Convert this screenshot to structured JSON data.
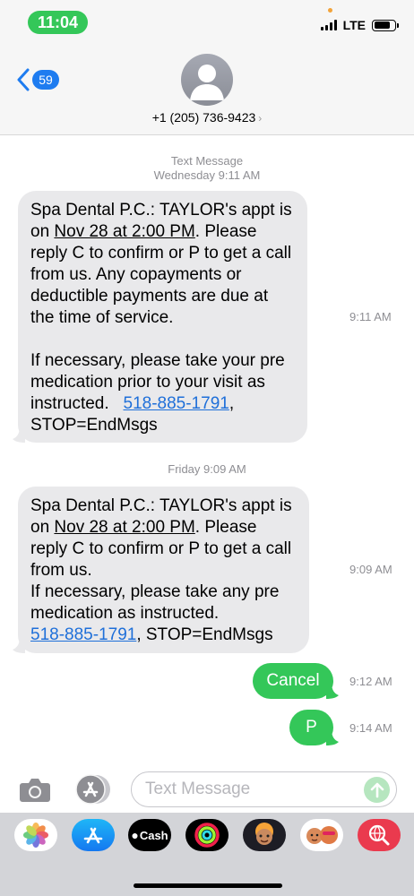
{
  "status_bar": {
    "time": "11:04",
    "network": "LTE",
    "battery_level": 0.8
  },
  "header": {
    "back_count": "59",
    "contact_number": "+1 (205) 736-9423",
    "chevron": "›"
  },
  "conversation": {
    "stamp1_label": "Text Message",
    "stamp1_time": "Wednesday 9:11 AM",
    "msg1": {
      "p1_a": "Spa Dental P.C.: TAYLOR's appt is on ",
      "p1_date": "Nov 28 at 2:00 PM",
      "p1_b": ". Please reply C to confirm or P to get a call from us. Any copayments or deductible payments are due at the time of service.",
      "p2_a": "If necessary, please take your pre medication prior to your visit as instructed.   ",
      "p2_phone": "518-885-1791",
      "p2_b": ", STOP=EndMsgs",
      "time": "9:11 AM"
    },
    "stamp2_time": "Friday 9:09 AM",
    "msg2": {
      "p1_a": "Spa Dental P.C.: TAYLOR's appt is on ",
      "p1_date": "Nov 28 at 2:00 PM",
      "p1_b": ". Please reply C to confirm or P to get a call from us.",
      "p2_a": "If necessary, please take any pre medication as instructed.",
      "p2_phone": "518-885-1791",
      "p2_b": ", STOP=EndMsgs",
      "time": "9:09 AM"
    },
    "msg3": {
      "text": "Cancel",
      "time": "9:12 AM"
    },
    "msg4": {
      "text": "P",
      "time": "9:14 AM"
    }
  },
  "compose": {
    "placeholder": "Text Message"
  },
  "app_drawer": {
    "apps": [
      {
        "name": "photos-icon"
      },
      {
        "name": "app-store-icon"
      },
      {
        "name": "apple-cash-icon",
        "label": "Cash"
      },
      {
        "name": "activity-icon"
      },
      {
        "name": "memoji-icon"
      },
      {
        "name": "memoji-stickers-icon"
      },
      {
        "name": "web-search-icon"
      }
    ]
  },
  "colors": {
    "imessage_green": "#34c759",
    "incoming_gray": "#e9e9eb",
    "link_blue": "#1e6fd9",
    "back_blue": "#1e7cf0"
  }
}
